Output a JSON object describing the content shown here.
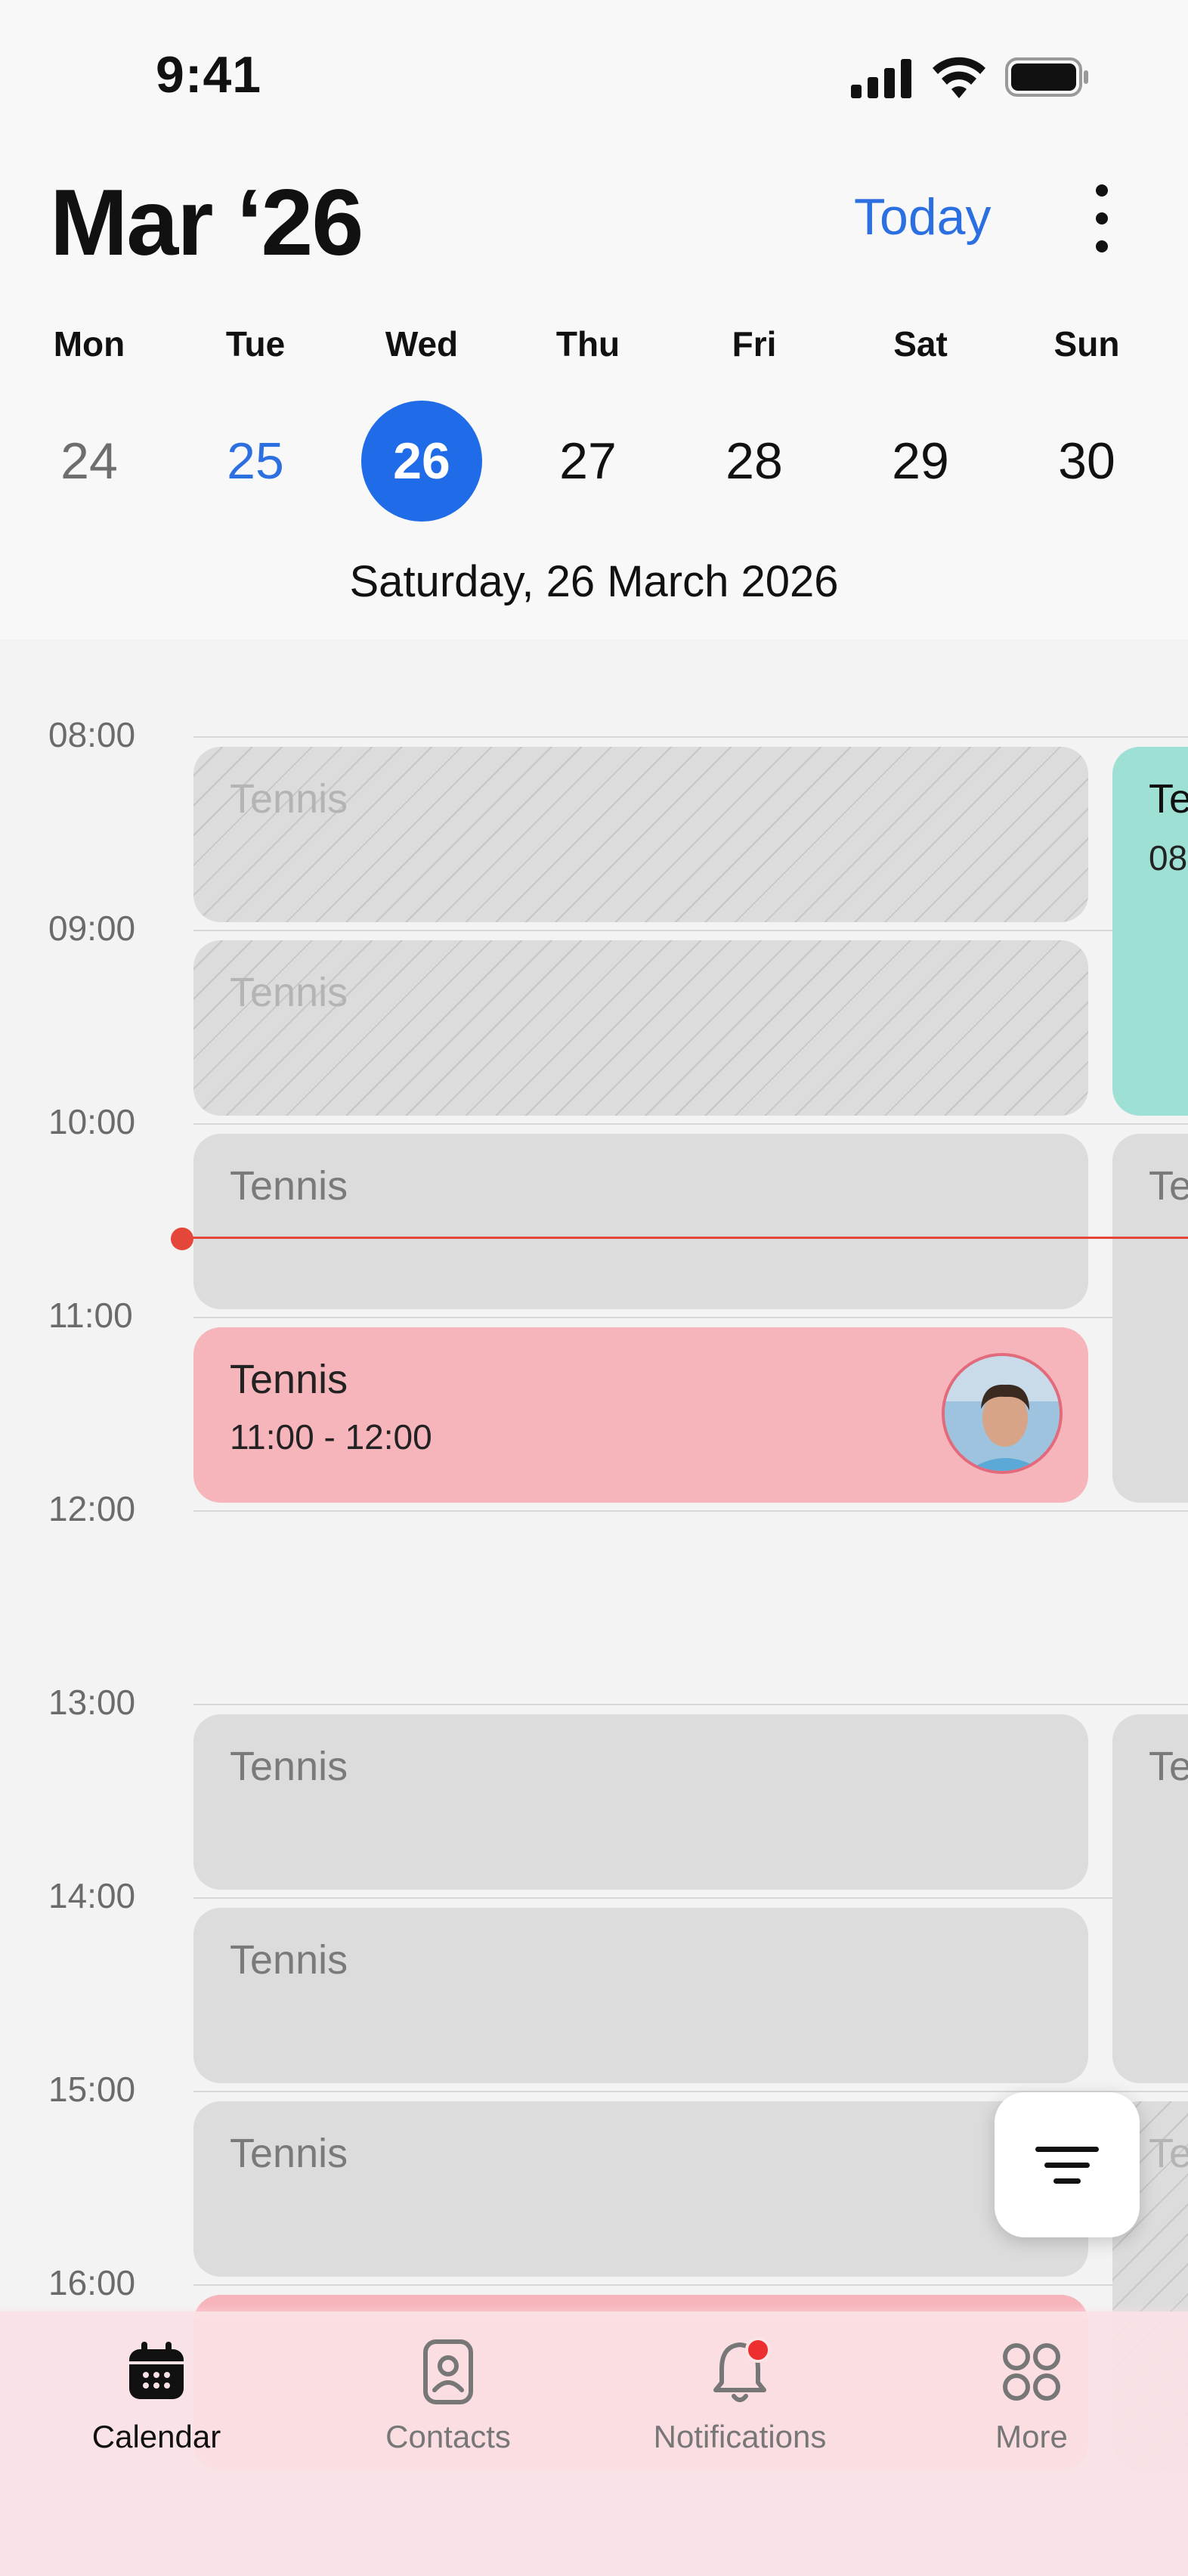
{
  "status_bar": {
    "time": "9:41"
  },
  "header": {
    "month_title": "Mar ‘26",
    "today_label": "Today",
    "selected_date": "Saturday, 26 March 2026"
  },
  "week": [
    {
      "name": "Mon",
      "num": "24",
      "state": "past"
    },
    {
      "name": "Tue",
      "num": "25",
      "state": "today"
    },
    {
      "name": "Wed",
      "num": "26",
      "state": "selected"
    },
    {
      "name": "Thu",
      "num": "27",
      "state": "future"
    },
    {
      "name": "Fri",
      "num": "28",
      "state": "future"
    },
    {
      "name": "Sat",
      "num": "29",
      "state": "future"
    },
    {
      "name": "Sun",
      "num": "30",
      "state": "future"
    }
  ],
  "hours": [
    "08:00",
    "09:00",
    "10:00",
    "11:00",
    "12:00",
    "13:00",
    "14:00",
    "15:00",
    "16:00"
  ],
  "events": [
    {
      "title": "Tennis",
      "time": "",
      "style": "hatch"
    },
    {
      "title": "Tennis",
      "time": "",
      "style": "hatch"
    },
    {
      "title": "Tennis",
      "time": "",
      "style": "grey"
    },
    {
      "title": "Tennis",
      "time": "11:00 - 12:00",
      "style": "pink"
    },
    {
      "title": "Tennis",
      "time": "",
      "style": "grey"
    },
    {
      "title": "Tennis",
      "time": "",
      "style": "grey"
    },
    {
      "title": "Tennis",
      "time": "",
      "style": "grey"
    }
  ],
  "side_events": [
    {
      "title": "Te",
      "time": "08",
      "style": "teal"
    },
    {
      "title": "Te",
      "time": "",
      "style": "grey"
    },
    {
      "title": "Te",
      "time": "",
      "style": "grey"
    },
    {
      "title": "Te",
      "time": "",
      "style": "hatch"
    }
  ],
  "tabs": [
    {
      "label": "Calendar",
      "icon": "calendar-icon",
      "active": true
    },
    {
      "label": "Contacts",
      "icon": "contact-icon",
      "active": false
    },
    {
      "label": "Notifications",
      "icon": "bell-icon",
      "active": false
    },
    {
      "label": "More",
      "icon": "grid-icon",
      "active": false
    }
  ],
  "colors": {
    "accent": "#1f6be8",
    "now_line": "#e5463a",
    "event_pink": "#f6b4bb",
    "event_teal": "#9fe0d5",
    "event_grey": "#dcdcdd"
  }
}
